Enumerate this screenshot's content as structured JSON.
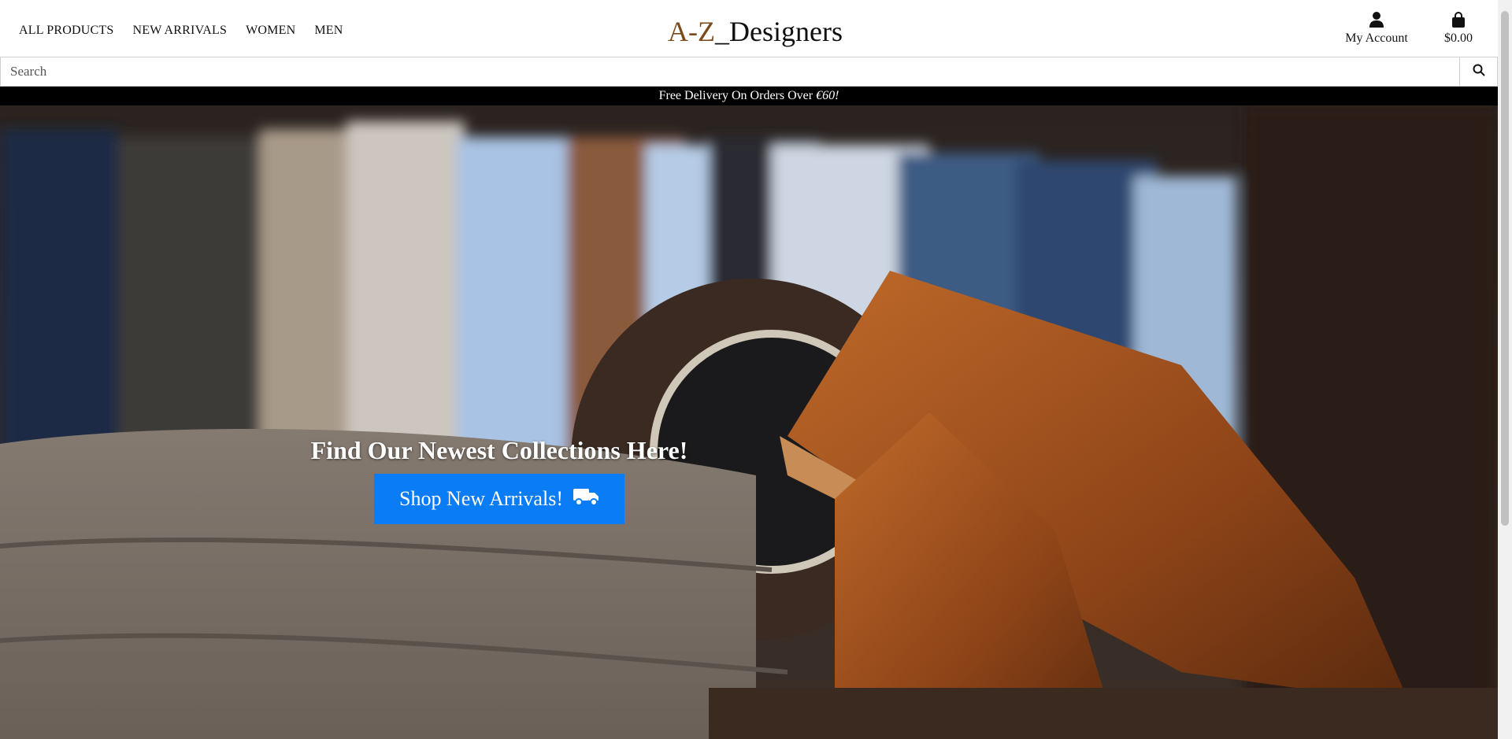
{
  "nav": {
    "items": [
      {
        "label": "ALL PRODUCTS"
      },
      {
        "label": "NEW ARRIVALS"
      },
      {
        "label": "WOMEN"
      },
      {
        "label": "MEN"
      }
    ]
  },
  "logo": {
    "accent": "A-Z",
    "rest": "_Designers",
    "accent_color": "#7a4a1a"
  },
  "account": {
    "label": "My Account",
    "icon": "user-icon"
  },
  "cart": {
    "total": "$0.00",
    "icon": "shopping-bag-icon"
  },
  "search": {
    "placeholder": "Search",
    "value": "",
    "icon": "search-icon"
  },
  "promo": {
    "text": "Free Delivery On Orders Over ",
    "amount": "€60!"
  },
  "hero": {
    "title": "Find Our Newest Collections Here!",
    "button_label": "Shop New Arrivals!",
    "button_icon": "truck-icon",
    "button_color": "#0a7cf5"
  }
}
